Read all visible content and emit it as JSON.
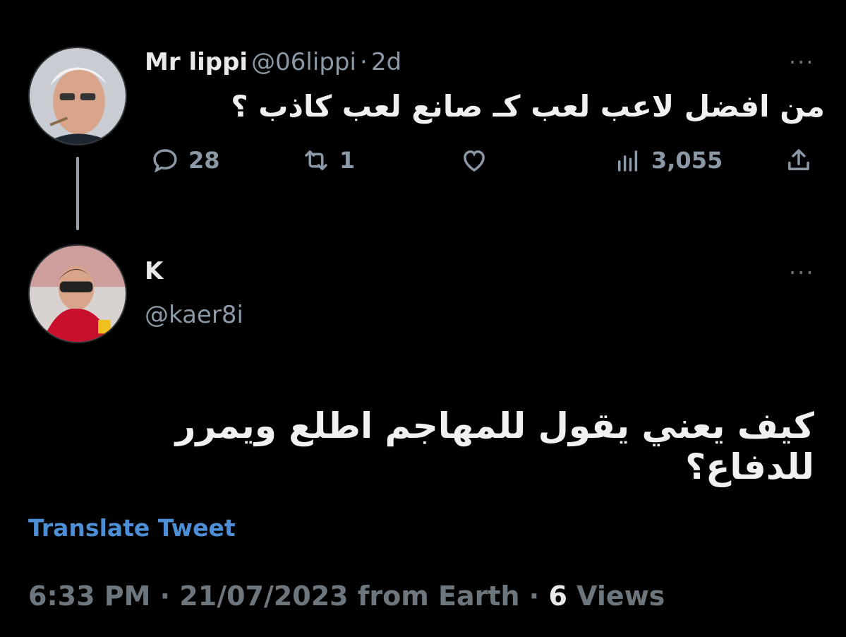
{
  "tweet1": {
    "name": "Mr lippi",
    "handle": "@06lippi",
    "separator": "·",
    "time": "2d",
    "more": "···",
    "text": "من افضل لاعب لعب كـ صانع لعب كاذب ؟",
    "replies": "28",
    "retweets": "1",
    "views": "3,055"
  },
  "tweet2": {
    "name": "K",
    "handle": "@kaer8i",
    "more": "···",
    "text": "كيف يعني يقول للمهاجم اطلع ويمرر للدفاع؟",
    "translate_label": "Translate Tweet",
    "meta_prefix": "6:33 PM · 21/07/2023 from Earth · ",
    "views_count": "6",
    "views_label": " Views"
  },
  "colors": {
    "background": "#000000",
    "text": "#e7e9ea",
    "muted": "#6e767d",
    "link": "#4d8fd6"
  }
}
